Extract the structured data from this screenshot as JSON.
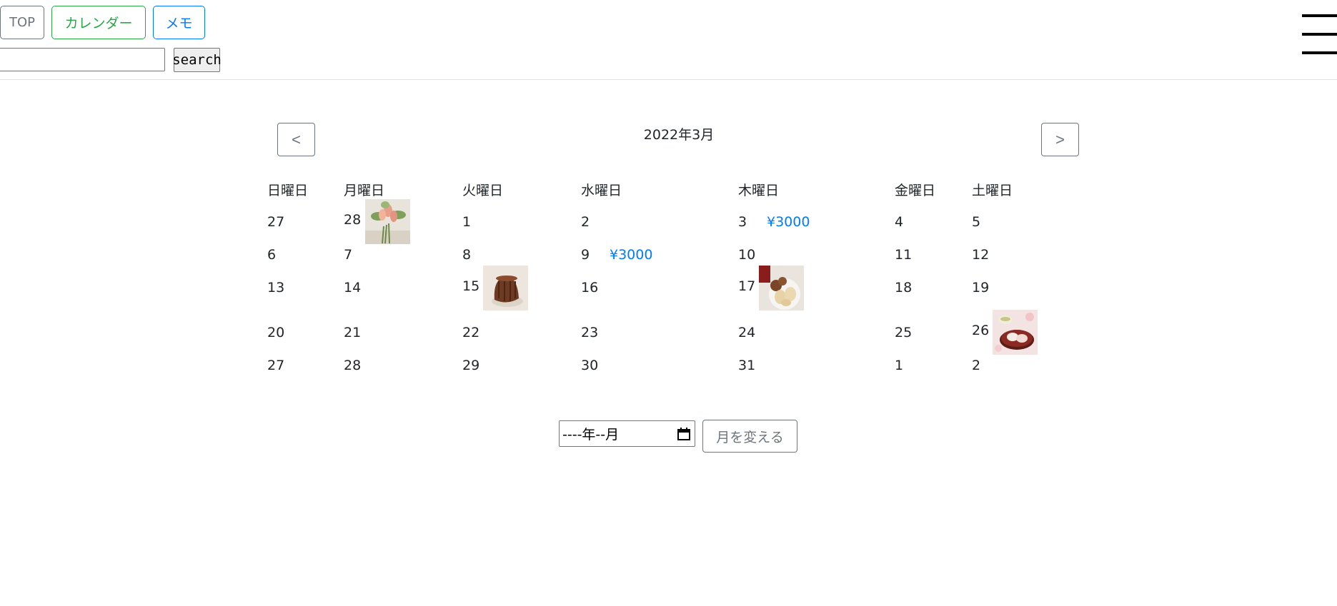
{
  "nav": {
    "top_label": "TOP",
    "calendar_label": "カレンダー",
    "memo_label": "メモ"
  },
  "search": {
    "value": "",
    "button_label": "search"
  },
  "calendar": {
    "prev_label": "<",
    "next_label": ">",
    "month_title": "2022年3月",
    "weekdays": [
      "日曜日",
      "月曜日",
      "火曜日",
      "水曜日",
      "木曜日",
      "金曜日",
      "土曜日"
    ],
    "weeks": [
      [
        "27",
        "28",
        "1",
        "2",
        "3",
        "4",
        "5"
      ],
      [
        "6",
        "7",
        "8",
        "9",
        "10",
        "11",
        "12"
      ],
      [
        "13",
        "14",
        "15",
        "16",
        "17",
        "18",
        "19"
      ],
      [
        "20",
        "21",
        "22",
        "23",
        "24",
        "25",
        "26"
      ],
      [
        "27",
        "28",
        "29",
        "30",
        "31",
        "1",
        "2"
      ]
    ],
    "prices": {
      "thu_3": "¥3000",
      "wed_9": "¥3000"
    },
    "images": {
      "mon_28": "flowers-image",
      "tue_15": "canele-image",
      "thu_17": "cookies-image",
      "sat_26": "wagashi-image"
    }
  },
  "month_picker": {
    "value": "----年--月",
    "button_label": "月を変える"
  },
  "colors": {
    "green": "#28a745",
    "blue": "#007bff",
    "gray": "#6c757d"
  }
}
